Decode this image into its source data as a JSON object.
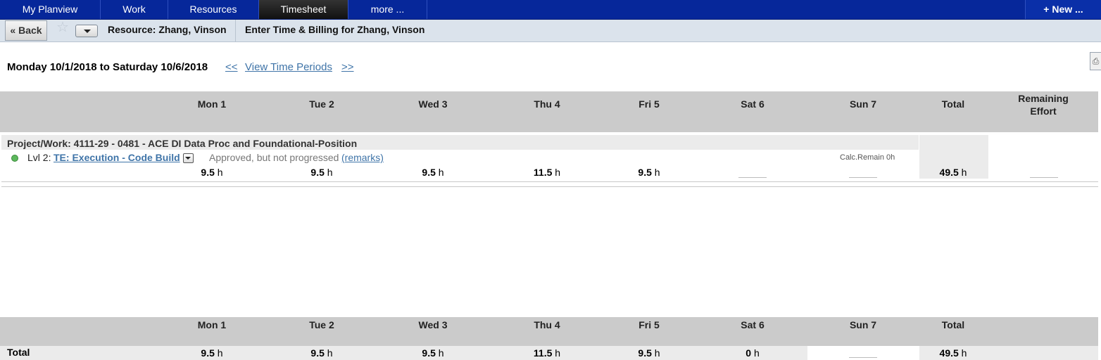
{
  "nav": {
    "tabs": [
      "My Planview",
      "Work",
      "Resources",
      "Timesheet",
      "more ..."
    ],
    "active": "Timesheet",
    "new_label": "+ New ..."
  },
  "subbar": {
    "back_label": "Back",
    "resource_label": "Resource:  Zhang, Vinson",
    "title": "Enter Time & Billing for Zhang, Vinson"
  },
  "period": {
    "range": "Monday 10/1/2018 to Saturday 10/6/2018",
    "prev": "<<",
    "view": "View Time Periods",
    "next": ">>"
  },
  "columns": [
    "Mon 1",
    "Tue 2",
    "Wed 3",
    "Thu 4",
    "Fri 5",
    "Sat 6",
    "Sun 7",
    "Total"
  ],
  "remaining_header": "Remaining Effort",
  "project": {
    "label": "Project/Work: 4111-29 - 0481 - ACE DI Data Proc and Foundational-Position"
  },
  "task": {
    "level": "Lvl 2:",
    "name": "TE: Execution - Code Build",
    "status": "Approved, but not progressed",
    "remarks": "(remarks)",
    "calc_remain": "Calc.Remain 0h",
    "hours": [
      "9.5",
      "9.5",
      "9.5",
      "11.5",
      "9.5"
    ],
    "total": "49.5",
    "unit": "h"
  },
  "footer": {
    "total_label": "Total",
    "hours": [
      "9.5",
      "9.5",
      "9.5",
      "11.5",
      "9.5",
      "0"
    ],
    "total": "49.5",
    "unit": "h"
  }
}
